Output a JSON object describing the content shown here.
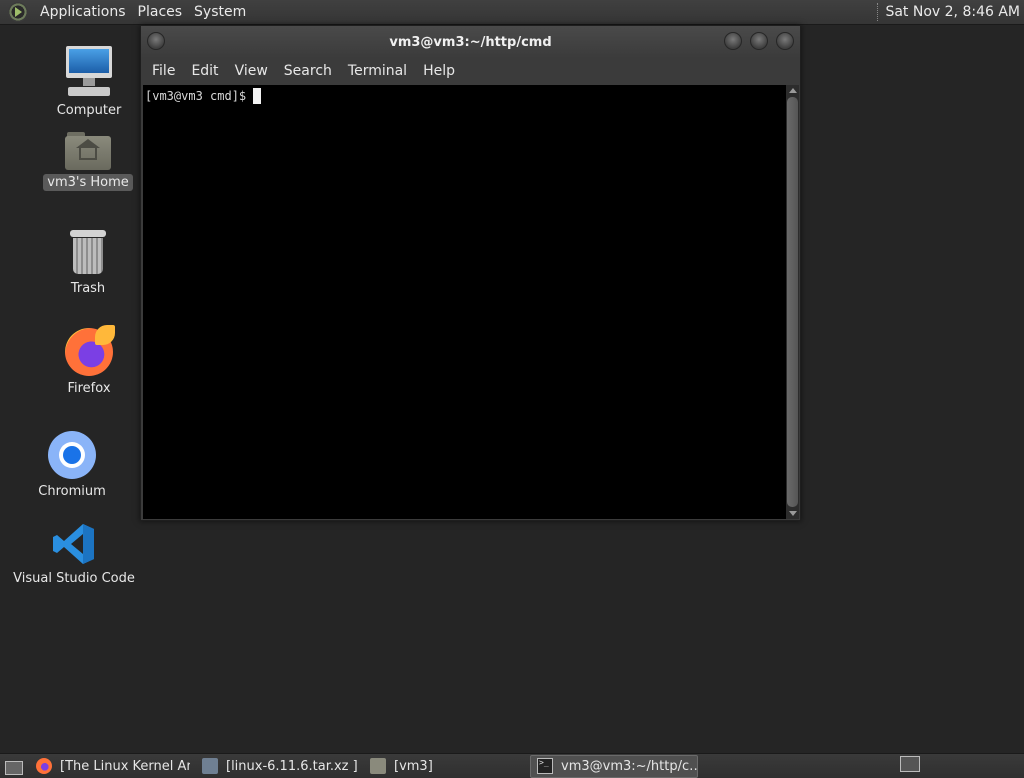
{
  "top_panel": {
    "menus": [
      "Applications",
      "Places",
      "System"
    ],
    "clock": "Sat Nov  2,  8:46 AM"
  },
  "desktop_icons": [
    {
      "name": "computer",
      "label": "Computer",
      "icon": "computer-icon"
    },
    {
      "name": "home",
      "label": "vm3's Home",
      "icon": "home-folder-icon",
      "selected": true
    },
    {
      "name": "trash",
      "label": "Trash",
      "icon": "trash-icon"
    },
    {
      "name": "firefox",
      "label": "Firefox",
      "icon": "firefox-icon"
    },
    {
      "name": "chromium",
      "label": "Chromium",
      "icon": "chromium-icon"
    },
    {
      "name": "vscode",
      "label": "Visual Studio Code",
      "icon": "vscode-icon"
    }
  ],
  "terminal": {
    "title": "vm3@vm3:~/http/cmd",
    "menu": [
      "File",
      "Edit",
      "View",
      "Search",
      "Terminal",
      "Help"
    ],
    "prompt": "[vm3@vm3 cmd]$"
  },
  "taskbar": {
    "tasks": [
      {
        "label": "[The Linux Kernel Ar…",
        "icon": "firefox-icon"
      },
      {
        "label": "[linux-6.11.6.tar.xz ]",
        "icon": "archive-icon"
      },
      {
        "label": "[vm3]",
        "icon": "folder-icon"
      },
      {
        "label": "vm3@vm3:~/http/c…",
        "icon": "terminal-icon",
        "active": true
      }
    ]
  },
  "colors": {
    "desktop_bg": "#252525",
    "panel_bg": "#3a3a3a",
    "terminal_bg": "#000000",
    "terminal_fg": "#d8d8d8"
  }
}
